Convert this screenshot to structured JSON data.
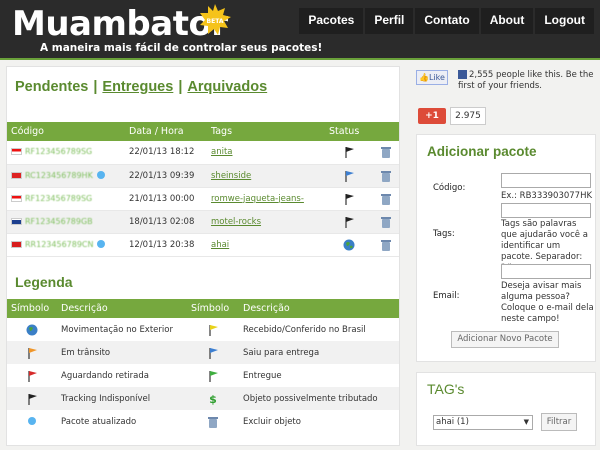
{
  "header": {
    "logo": "Muambator",
    "beta": "BETA",
    "tagline": "A maneira mais fácil de controlar seus pacotes!",
    "nav": [
      "Pacotes",
      "Perfil",
      "Contato",
      "About",
      "Logout"
    ]
  },
  "tabs": {
    "pendentes": "Pendentes",
    "entregues": "Entregues",
    "arquivados": "Arquivados",
    "separator": "|"
  },
  "packages": {
    "headers": [
      "Código",
      "Data / Hora",
      "Tags",
      "Status"
    ],
    "rows": [
      {
        "code": "RF123456789SG",
        "date": "22/01/13 18:12",
        "tag": "anita",
        "status_icon": "black-flag-icon",
        "updated": false
      },
      {
        "code": "RC123456789HK",
        "date": "22/01/13 09:39",
        "tag": "sheinside",
        "status_icon": "blue-flag-icon",
        "updated": true
      },
      {
        "code": "RF123456789SG",
        "date": "21/01/13 00:00",
        "tag": "romwe-jaqueta-jeans-",
        "status_icon": "black-flag-icon",
        "updated": false
      },
      {
        "code": "RF123456789GB",
        "date": "18/01/13 02:08",
        "tag": "motel-rocks",
        "status_icon": "black-flag-icon",
        "updated": false
      },
      {
        "code": "RR123456789CN",
        "date": "12/01/13 20:38",
        "tag": "ahai",
        "status_icon": "globe-icon",
        "updated": true
      }
    ]
  },
  "legend": {
    "title": "Legenda",
    "headers": [
      "Símbolo",
      "Descrição",
      "Símbolo",
      "Descrição"
    ],
    "rows": [
      [
        "Movimentação no Exterior",
        "Recebido/Conferido no Brasil"
      ],
      [
        "Em trânsito",
        "Saiu para entrega"
      ],
      [
        "Aguardando retirada",
        "Entregue"
      ],
      [
        "Tracking Indisponível",
        "Objeto possivelmente tributado"
      ],
      [
        "Pacote atualizado",
        "Excluir objeto"
      ]
    ]
  },
  "social": {
    "like": "Like",
    "fb_text": "2,555 people like this. Be the first of your friends.",
    "gplus": "+1",
    "gplus_count": "2.975"
  },
  "add_form": {
    "title": "Adicionar pacote",
    "codigo_label": "Código:",
    "codigo_hint": "Ex.: RB333903077HK",
    "tags_label": "Tags:",
    "tags_hint": "Tags são palavras que ajudarão você a identificar um pacote. Separador: \",\"",
    "email_label": "Email:",
    "email_hint": "Deseja avisar mais alguma pessoa? Coloque o e-mail dela neste campo!",
    "submit": "Adicionar Novo Pacote"
  },
  "tags_box": {
    "title": "TAG's",
    "selected": "ahai (1)",
    "filter": "Filtrar"
  },
  "colors": {
    "green": "#76a83e",
    "header_bg": "#2b2b2b"
  }
}
